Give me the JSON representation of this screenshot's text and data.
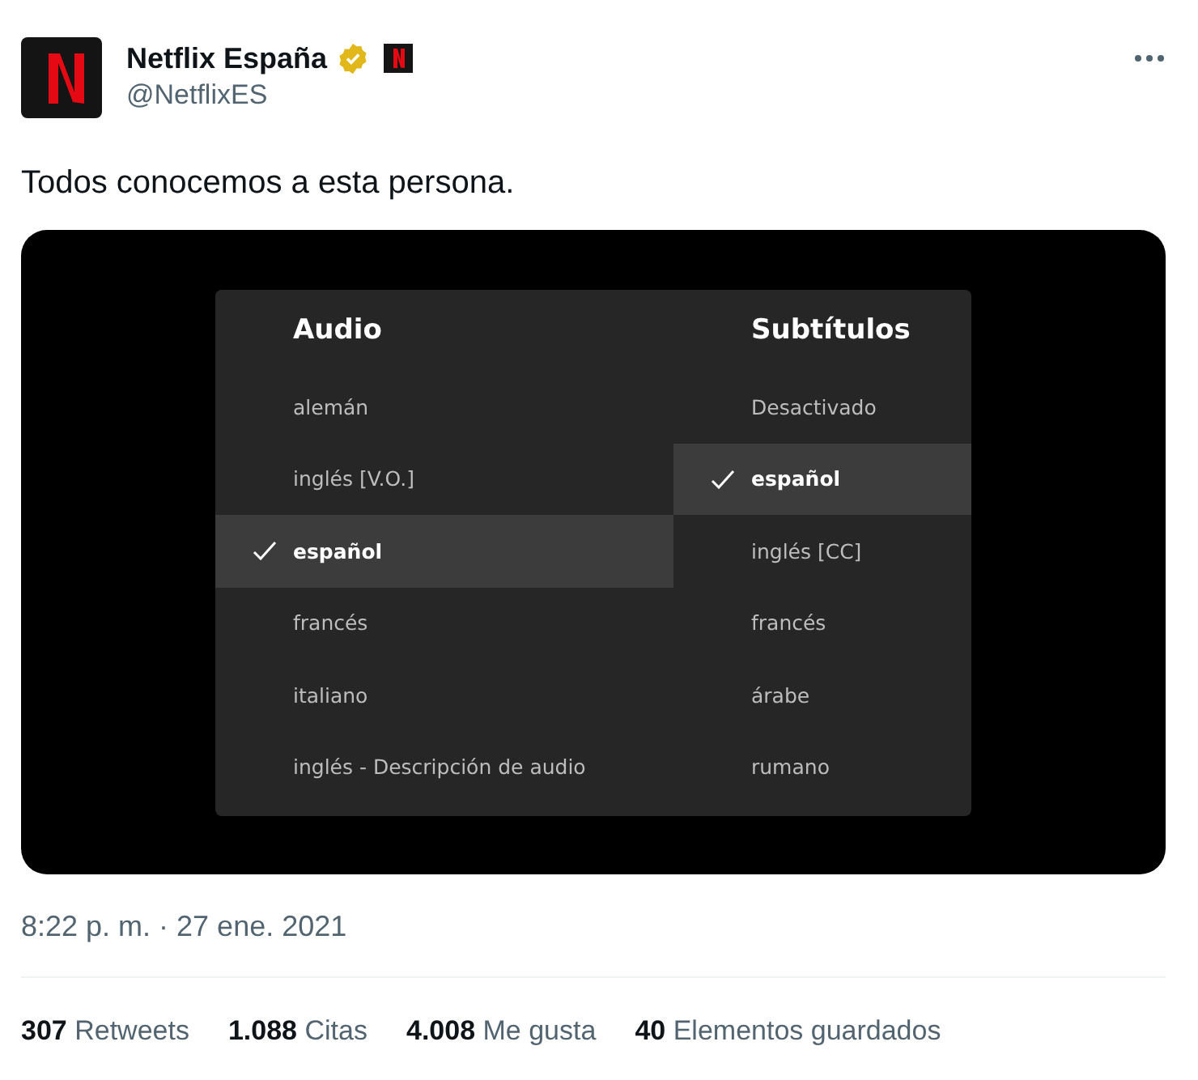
{
  "author": {
    "name": "Netflix España",
    "verified": true,
    "handle": "@NetflixES"
  },
  "text": "Todos conocemos a esta persona.",
  "media": {
    "columns": [
      {
        "title": "Audio",
        "items": [
          {
            "label": "alemán",
            "selected": false
          },
          {
            "label": "inglés [V.O.]",
            "selected": false
          },
          {
            "label": "español",
            "selected": true
          },
          {
            "label": "francés",
            "selected": false
          },
          {
            "label": "italiano",
            "selected": false
          },
          {
            "label": "inglés - Descripción de audio",
            "selected": false
          }
        ]
      },
      {
        "title": "Subtítulos",
        "items": [
          {
            "label": "Desactivado",
            "selected": false
          },
          {
            "label": "español",
            "selected": true
          },
          {
            "label": "inglés [CC]",
            "selected": false
          },
          {
            "label": "francés",
            "selected": false
          },
          {
            "label": "árabe",
            "selected": false
          },
          {
            "label": "rumano",
            "selected": false
          }
        ]
      }
    ]
  },
  "timestamp": "8:22 p. m. · 27 ene. 2021",
  "stats": [
    {
      "count": "307",
      "label": "Retweets"
    },
    {
      "count": "1.088",
      "label": "Citas"
    },
    {
      "count": "4.008",
      "label": "Me gusta"
    },
    {
      "count": "40",
      "label": "Elementos guardados"
    }
  ]
}
